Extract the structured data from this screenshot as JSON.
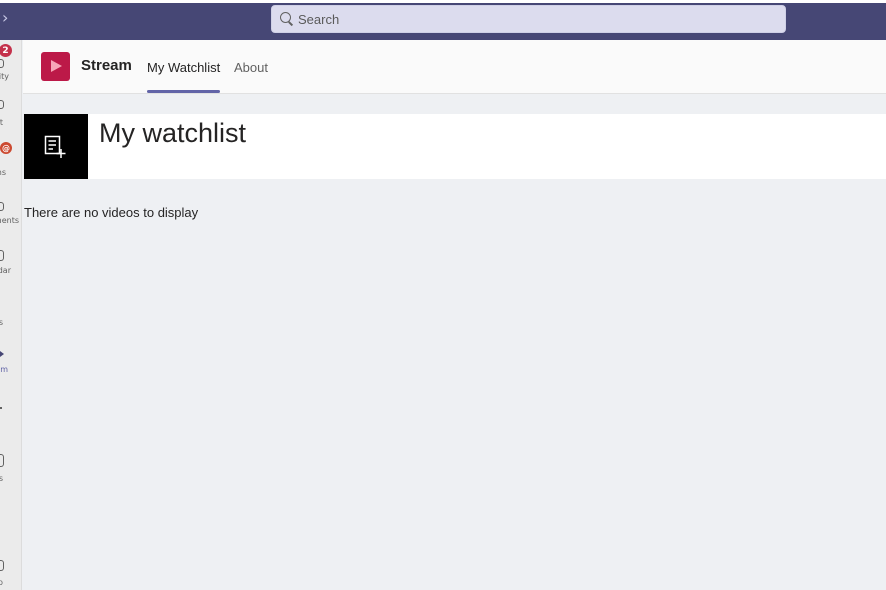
{
  "topbar": {
    "search_placeholder": "Search"
  },
  "rail": {
    "items": [
      {
        "label": "ity",
        "badge": "2"
      },
      {
        "label": "t"
      },
      {
        "label": "ns",
        "badge": "@"
      },
      {
        "label": "ments"
      },
      {
        "label": "dar"
      },
      {
        "label": "s"
      },
      {
        "label": "m"
      },
      {
        "label": "s"
      },
      {
        "label": "p"
      }
    ]
  },
  "app": {
    "name": "Stream",
    "tabs": [
      "My Watchlist",
      "About"
    ]
  },
  "main": {
    "title": "My watchlist",
    "empty_message": "There are no videos to display"
  },
  "colors": {
    "topbar": "#464775",
    "accent": "#6264a7",
    "app_logo": "#bc1948",
    "badge": "#c4314b"
  }
}
